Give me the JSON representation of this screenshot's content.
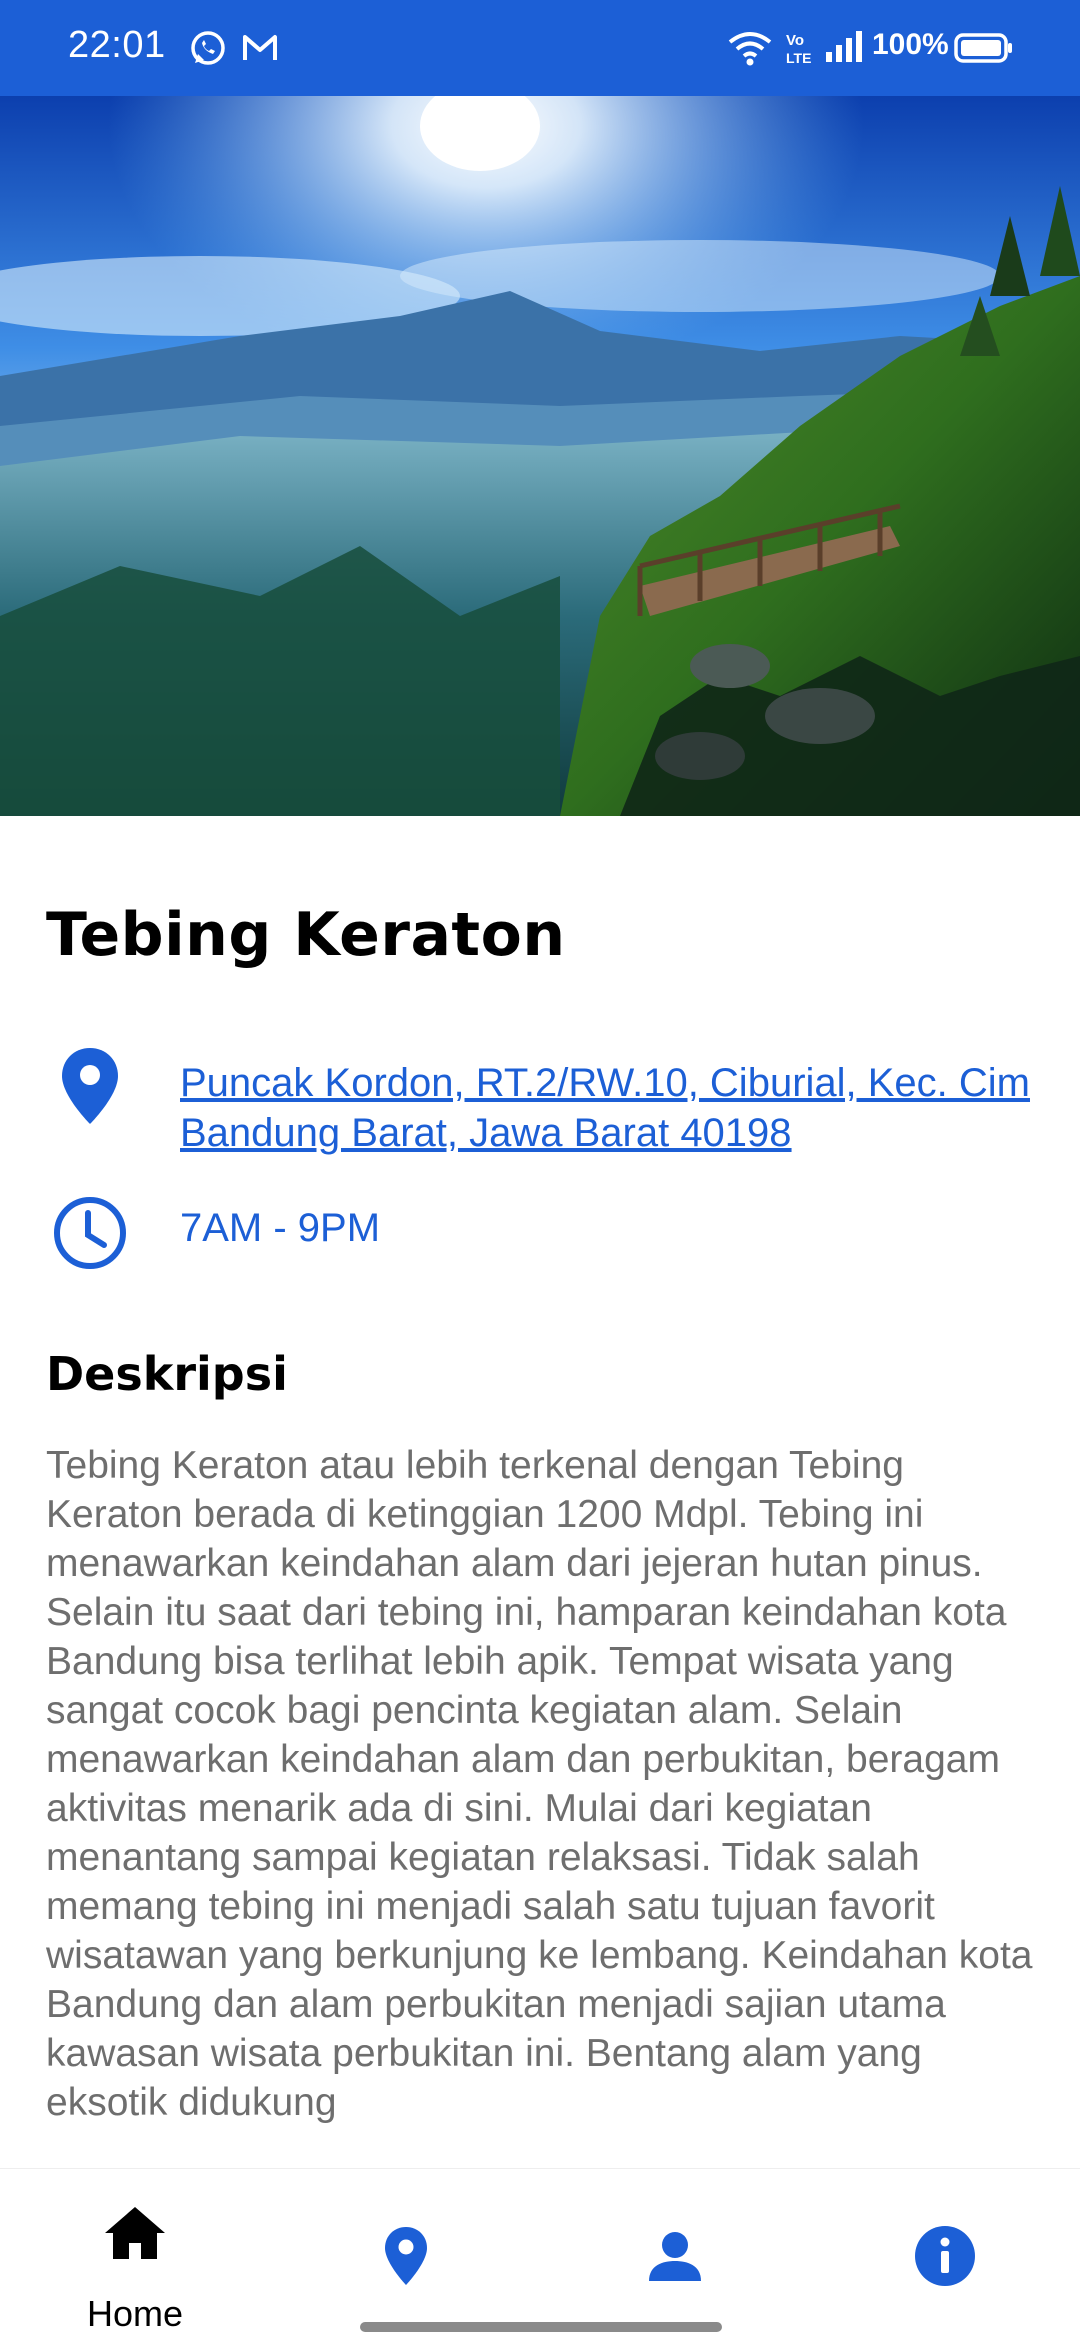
{
  "status_bar": {
    "time": "22:01",
    "battery": "100%",
    "icons": [
      "whatsapp-icon",
      "gmail-icon",
      "wifi-icon",
      "volte-icon",
      "signal-icon",
      "battery-icon"
    ]
  },
  "place": {
    "name": "Tebing Keraton",
    "address": "Puncak Kordon, RT.2/RW.10, Ciburial, Kec. Cim",
    "address_line2": "Bandung Barat, Jawa Barat 40198",
    "hours": "7AM - 9PM"
  },
  "description": {
    "heading": "Deskripsi",
    "body": "Tebing Keraton atau lebih terkenal dengan Tebing Keraton berada di ketinggian 1200 Mdpl. Tebing ini menawarkan keindahan alam dari jejeran hutan pinus. Selain itu saat dari tebing ini, hamparan keindahan kota Bandung bisa terlihat lebih apik. Tempat wisata yang sangat cocok bagi pencinta kegiatan alam.  Selain menawarkan keindahan alam dan perbukitan, beragam aktivitas menarik ada di sini. Mulai dari kegiatan menantang sampai kegiatan relaksasi. Tidak salah memang tebing ini menjadi salah satu tujuan favorit wisatawan yang berkunjung ke lembang. Keindahan kota Bandung dan alam perbukitan menjadi sajian utama kawasan wisata perbukitan ini. Bentang alam yang eksotik didukung"
  },
  "bottom_nav": {
    "home_label": "Home",
    "items": [
      "home-icon",
      "location-icon",
      "profile-icon",
      "info-icon"
    ]
  },
  "colors": {
    "accent": "#1c5fd6",
    "status_bar": "#1c5fd6",
    "text_secondary": "#6e6e6e"
  }
}
